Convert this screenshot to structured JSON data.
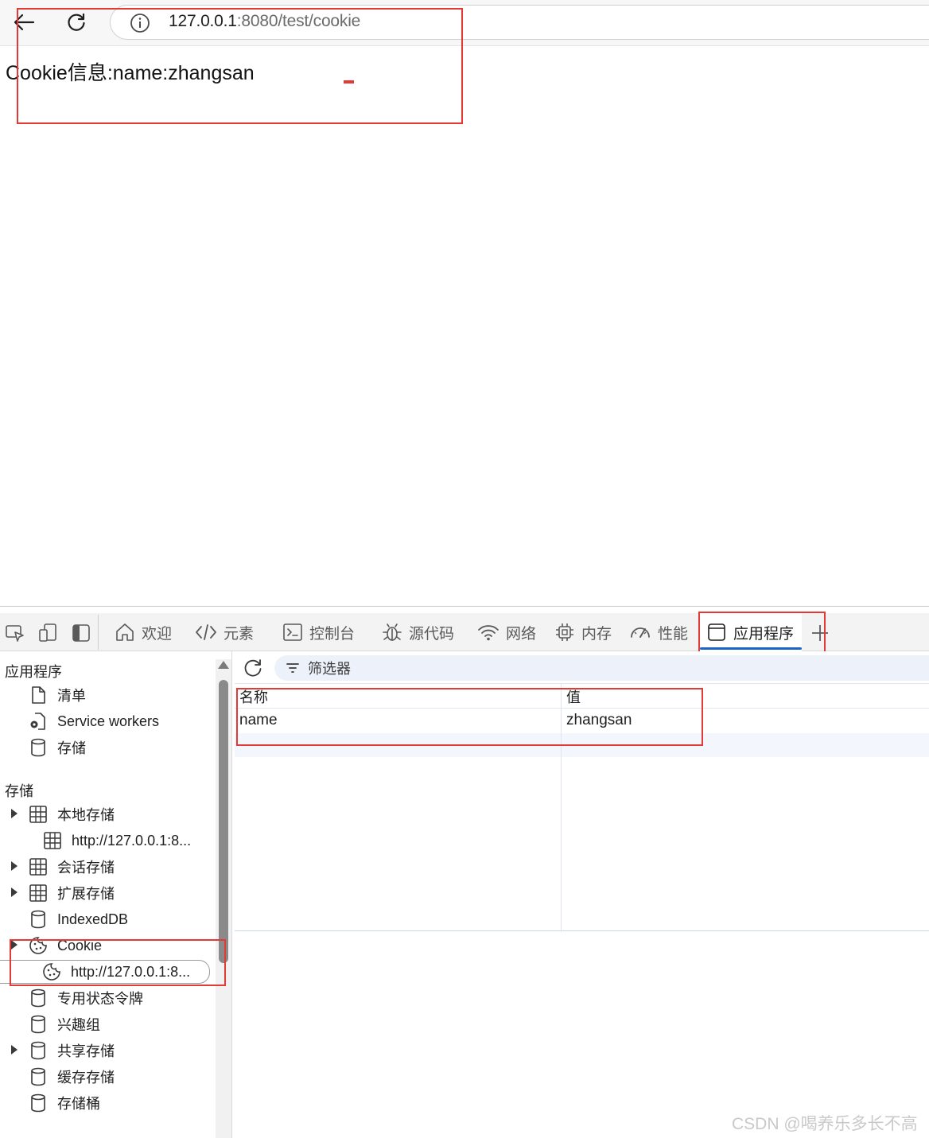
{
  "browser": {
    "url_host": "127.0.0.1",
    "url_path": ":8080/test/cookie"
  },
  "page": {
    "text": "Cookie信息:name:zhangsan"
  },
  "devtools": {
    "tabs": [
      {
        "label": "欢迎"
      },
      {
        "label": "元素"
      },
      {
        "label": "控制台"
      },
      {
        "label": "源代码"
      },
      {
        "label": "网络"
      },
      {
        "label": "内存"
      },
      {
        "label": "性能"
      },
      {
        "label": "应用程序"
      }
    ],
    "active_tab": "应用程序",
    "accent_color": "#1a64c8",
    "sidebar": {
      "app_section": "应用程序",
      "app_items": [
        "清单",
        "Service workers",
        "存储"
      ],
      "storage_section": "存储",
      "storage_items": [
        "本地存储",
        "http://127.0.0.1:8...",
        "会话存储",
        "扩展存储",
        "IndexedDB",
        "Cookie",
        "http://127.0.0.1:8...",
        "专用状态令牌",
        "兴趣组",
        "共享存储",
        "缓存存储",
        "存储桶"
      ]
    },
    "main": {
      "filter_placeholder": "筛选器",
      "columns": [
        "名称",
        "值"
      ],
      "rows": [
        {
          "name": "name",
          "value": "zhangsan"
        }
      ]
    }
  },
  "highlight_color": "#e53935",
  "watermark": "CSDN @喝养乐多长不高"
}
